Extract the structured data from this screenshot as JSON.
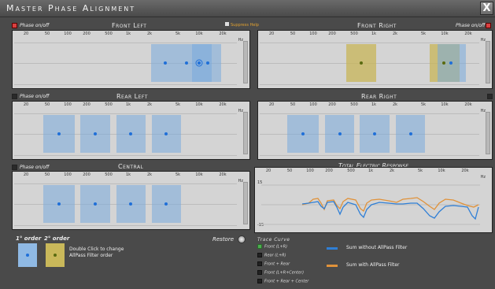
{
  "window": {
    "title": "Master Phase Alignment",
    "close": "X"
  },
  "phase_label": "Phase on/off",
  "suppress_label": "Suppress Help",
  "freq_ticks": [
    "20",
    "50",
    "100",
    "200",
    "500",
    "1k",
    "2k",
    "5k",
    "10k",
    "20k"
  ],
  "hz_label": "Hz",
  "sections": {
    "front_left": "Front Left",
    "front_right": "Front Right",
    "rear_left": "Rear Left",
    "rear_right": "Rear Right",
    "central": "Central",
    "total": "Total Electric Response"
  },
  "total_axis": {
    "top": "15",
    "bottom": "-15"
  },
  "orders": {
    "first": "1° order",
    "second": "2° order",
    "note": "Double Click to change AllPass Filter order"
  },
  "restore_label": "Restore",
  "trace": {
    "title": "Trace Curve",
    "items": [
      "Front (L+R)",
      "Rear (L+R)",
      "Front + Rear",
      "Front (L+R+Center)",
      "Front + Rear + Center"
    ],
    "active_index": 0
  },
  "legend": {
    "without": "Sum without AllPass Filter",
    "with": "Sum with AllPass Filter"
  },
  "colors": {
    "without": "#2f7fd6",
    "with": "#e0923a",
    "band": "#8fb9e4",
    "band_second": "#c9b85a"
  }
}
